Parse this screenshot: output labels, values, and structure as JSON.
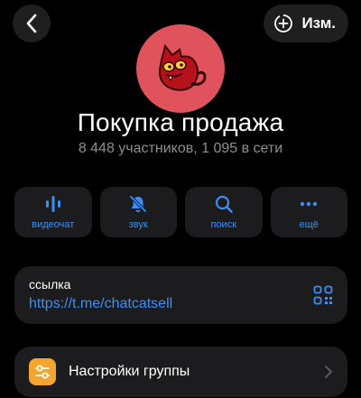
{
  "header": {
    "edit_label": "Изм."
  },
  "group": {
    "name": "Покупка продажа",
    "stats": "8 448 участников, 1 095 в сети",
    "avatar_color": "#e0525c"
  },
  "actions": [
    {
      "label": "видеочат",
      "icon": "voice-chat-icon"
    },
    {
      "label": "звук",
      "icon": "bell-off-icon"
    },
    {
      "label": "поиск",
      "icon": "search-icon"
    },
    {
      "label": "ещё",
      "icon": "more-icon"
    }
  ],
  "link": {
    "title": "ссылка",
    "url": "https://t.me/chatcatsell",
    "icon": "qr-code-icon"
  },
  "settings": {
    "label": "Настройки группы",
    "icon": "sliders-icon",
    "icon_color": "#f2a52f"
  },
  "colors": {
    "accent": "#3b8ff5",
    "card": "#1c1c1e",
    "background": "#000000"
  }
}
